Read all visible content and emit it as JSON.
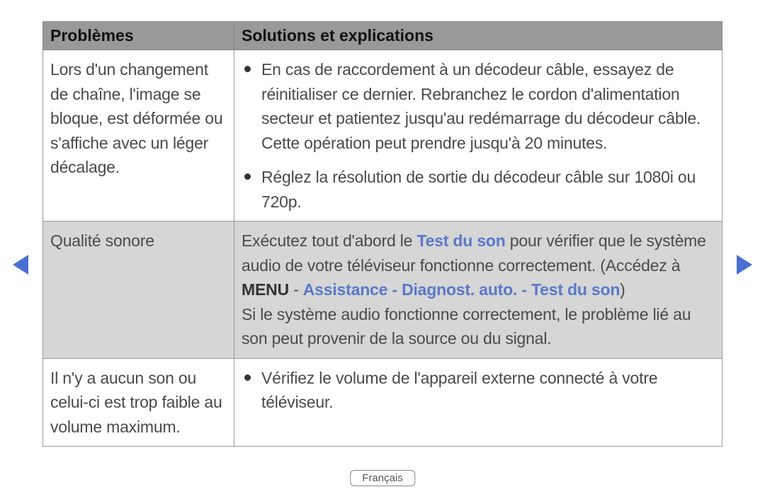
{
  "table": {
    "header": {
      "problems": "Problèmes",
      "solutions": "Solutions et explications"
    },
    "rows": [
      {
        "problem": "Lors d'un changement de chaîne, l'image se bloque, est déformée ou s'affiche avec un léger décalage.",
        "bullets": [
          "En cas de raccordement à un décodeur câble, essayez de réinitialiser ce dernier. Rebranchez le cordon d'alimentation secteur et patientez jusqu'au redémarrage du décodeur câble. Cette opération peut prendre jusqu'à 20 minutes.",
          "Réglez la résolution de sortie du décodeur câble sur 1080i ou 720p."
        ]
      },
      {
        "problem": "Qualité sonore",
        "solution_parts": {
          "p1_before": "Exécutez tout d'abord le ",
          "p1_blue1": "Test du son",
          "p1_after": " pour vérifier que le système audio de votre téléviseur fonctionne correctement. (Accédez à ",
          "p1_bold_menu": "MENU",
          "p1_dash": " - ",
          "p1_blue2": "Assistance - Diagnost. auto. - Test du son",
          "p1_close": ")",
          "p2": "Si le système audio fonctionne correctement, le problème lié au son peut provenir de la source ou du signal."
        }
      },
      {
        "problem": "Il n'y a aucun son ou celui-ci est trop faible au volume maximum.",
        "bullets": [
          "Vérifiez le volume de l'appareil externe connecté à votre téléviseur."
        ]
      }
    ]
  },
  "footer": {
    "language": "Français"
  }
}
